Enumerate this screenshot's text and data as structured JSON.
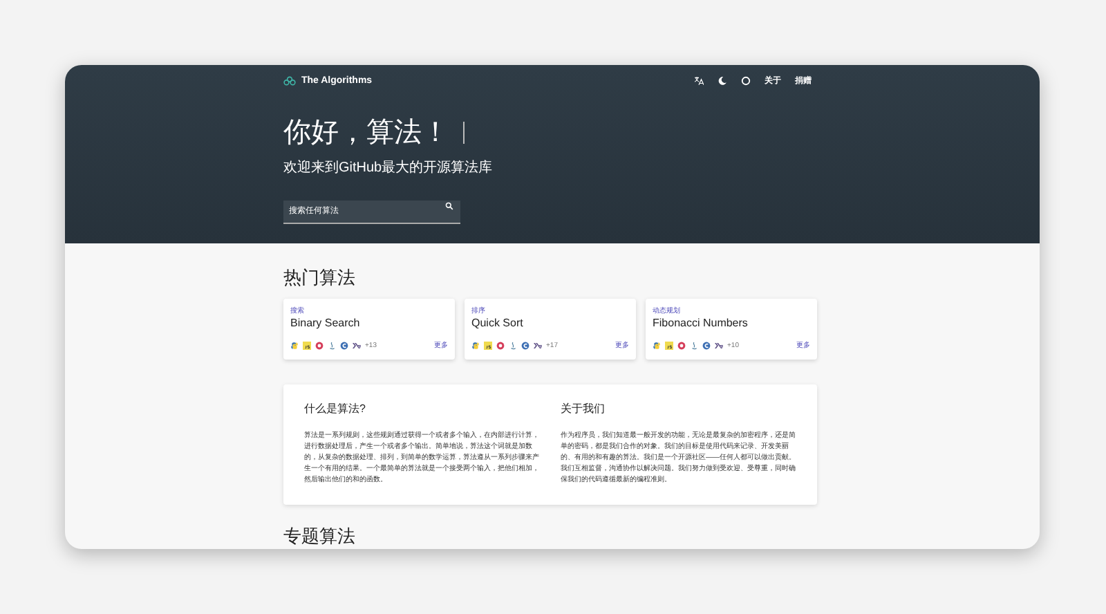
{
  "navbar": {
    "brand": "The Algorithms",
    "links": [
      "关于",
      "捐赠"
    ]
  },
  "hero": {
    "title": "你好，算法！",
    "subtitle": "欢迎来到GitHub最大的开源算法库",
    "search": {
      "placeholder": "搜索任何算法"
    }
  },
  "popular": {
    "heading": "热门算法",
    "cards": [
      {
        "category": "搜索",
        "name": "Binary Search",
        "extra": "+13",
        "more": "更多"
      },
      {
        "category": "排序",
        "name": "Quick Sort",
        "extra": "+17",
        "more": "更多"
      },
      {
        "category": "动态规划",
        "name": "Fibonacci Numbers",
        "extra": "+10",
        "more": "更多"
      }
    ]
  },
  "info": [
    {
      "heading": "什么是算法?",
      "text": "算法是一系列规则，这些规则通过获得一个或者多个输入，在内部进行计算，进行数据处理后，产生一个或者多个输出。简单地说，算法这个词就是加数的，从复杂的数据处理、排列，到简单的数学运算，算法遵从一系列步骤来产生一个有用的结果。一个最简单的算法就是一个接受两个输入，把他们相加，然后输出他们的和的函数。"
    },
    {
      "heading": "关于我们",
      "text": "作为程序员，我们知道最一般开发的功能，无论是最复杂的加密程序，还是简单的密码，都是我们合作的对象。我们的目标是使用代码来记录、开发美丽的、有用的和有趣的算法。我们是一个开源社区——任何人都可以做出贡献。我们互相监督，沟通协作以解决问题。我们努力做到受欢迎、受尊重，同时确保我们的代码遵循最新的编程准则。"
    }
  ],
  "next_heading": "专题算法"
}
